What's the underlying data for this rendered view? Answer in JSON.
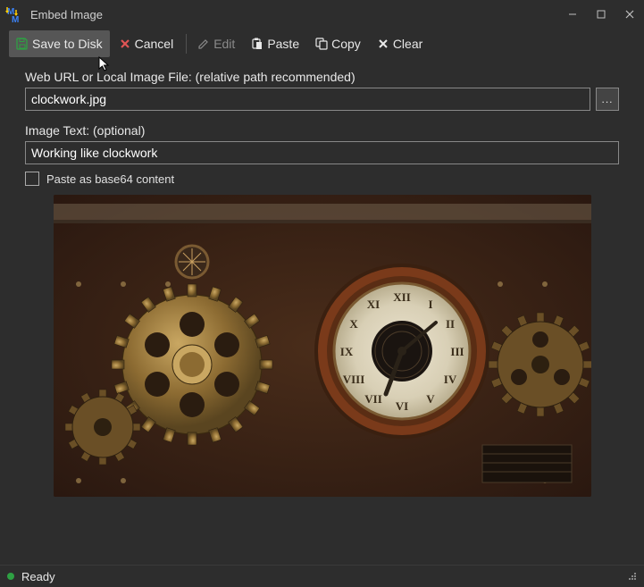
{
  "titlebar": {
    "title": "Embed Image"
  },
  "toolbar": {
    "save_label": "Save to Disk",
    "cancel_label": "Cancel",
    "edit_label": "Edit",
    "paste_label": "Paste",
    "copy_label": "Copy",
    "clear_label": "Clear"
  },
  "fields": {
    "url_label": "Web URL or Local Image File: (relative path recommended)",
    "url_value": "clockwork.jpg",
    "text_label": "Image Text: (optional)",
    "text_value": "Working like clockwork",
    "base64_label": "Paste as base64 content",
    "browse_label": "..."
  },
  "status": {
    "text": "Ready"
  }
}
